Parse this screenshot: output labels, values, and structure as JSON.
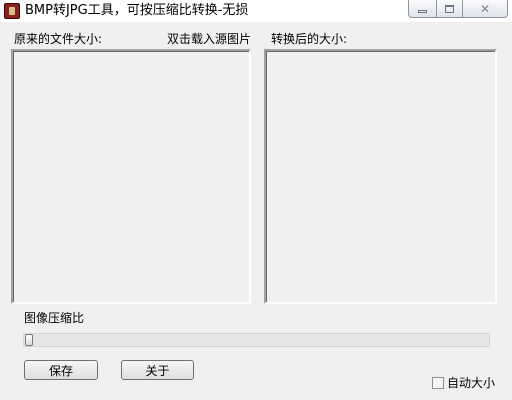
{
  "window": {
    "title": "BMP转JPG工具，可按压缩比转换-无损",
    "controls": {
      "minimize_icon": "minimize-icon",
      "maximize_icon": "maximize-icon",
      "close_icon": "close-icon",
      "close_glyph": "✕"
    }
  },
  "labels": {
    "original_size": "原来的文件大小:",
    "load_hint": "双击载入源图片",
    "converted_size": "转换后的大小:",
    "compression_ratio": "图像压缩比"
  },
  "slider": {
    "value": 0
  },
  "buttons": {
    "save": "保存",
    "about": "关于"
  },
  "auto_size": {
    "label": "自动大小",
    "checked": false
  }
}
